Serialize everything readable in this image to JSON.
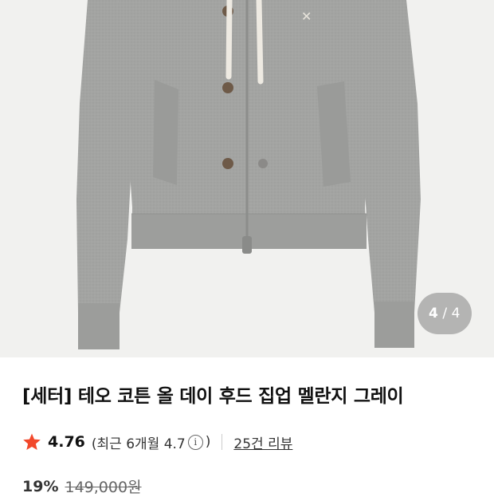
{
  "image_counter": {
    "current": "4",
    "separator": "/",
    "total": "4"
  },
  "product": {
    "title": "[세터] 테오 코튼 올 데이 후드 집업 멜란지 그레이",
    "rating": "4.76",
    "recent_prefix": "(최근 6개월 4.7",
    "recent_suffix": ")",
    "reviews_link": "25건 리뷰",
    "discount": "19%",
    "original_price": "149,000원"
  },
  "colors": {
    "star": "#f2482b",
    "photo_bg": "#f1f1ef",
    "garment": "#a3a4a2"
  },
  "icons": {
    "star": "star-icon",
    "info": "info-icon"
  }
}
